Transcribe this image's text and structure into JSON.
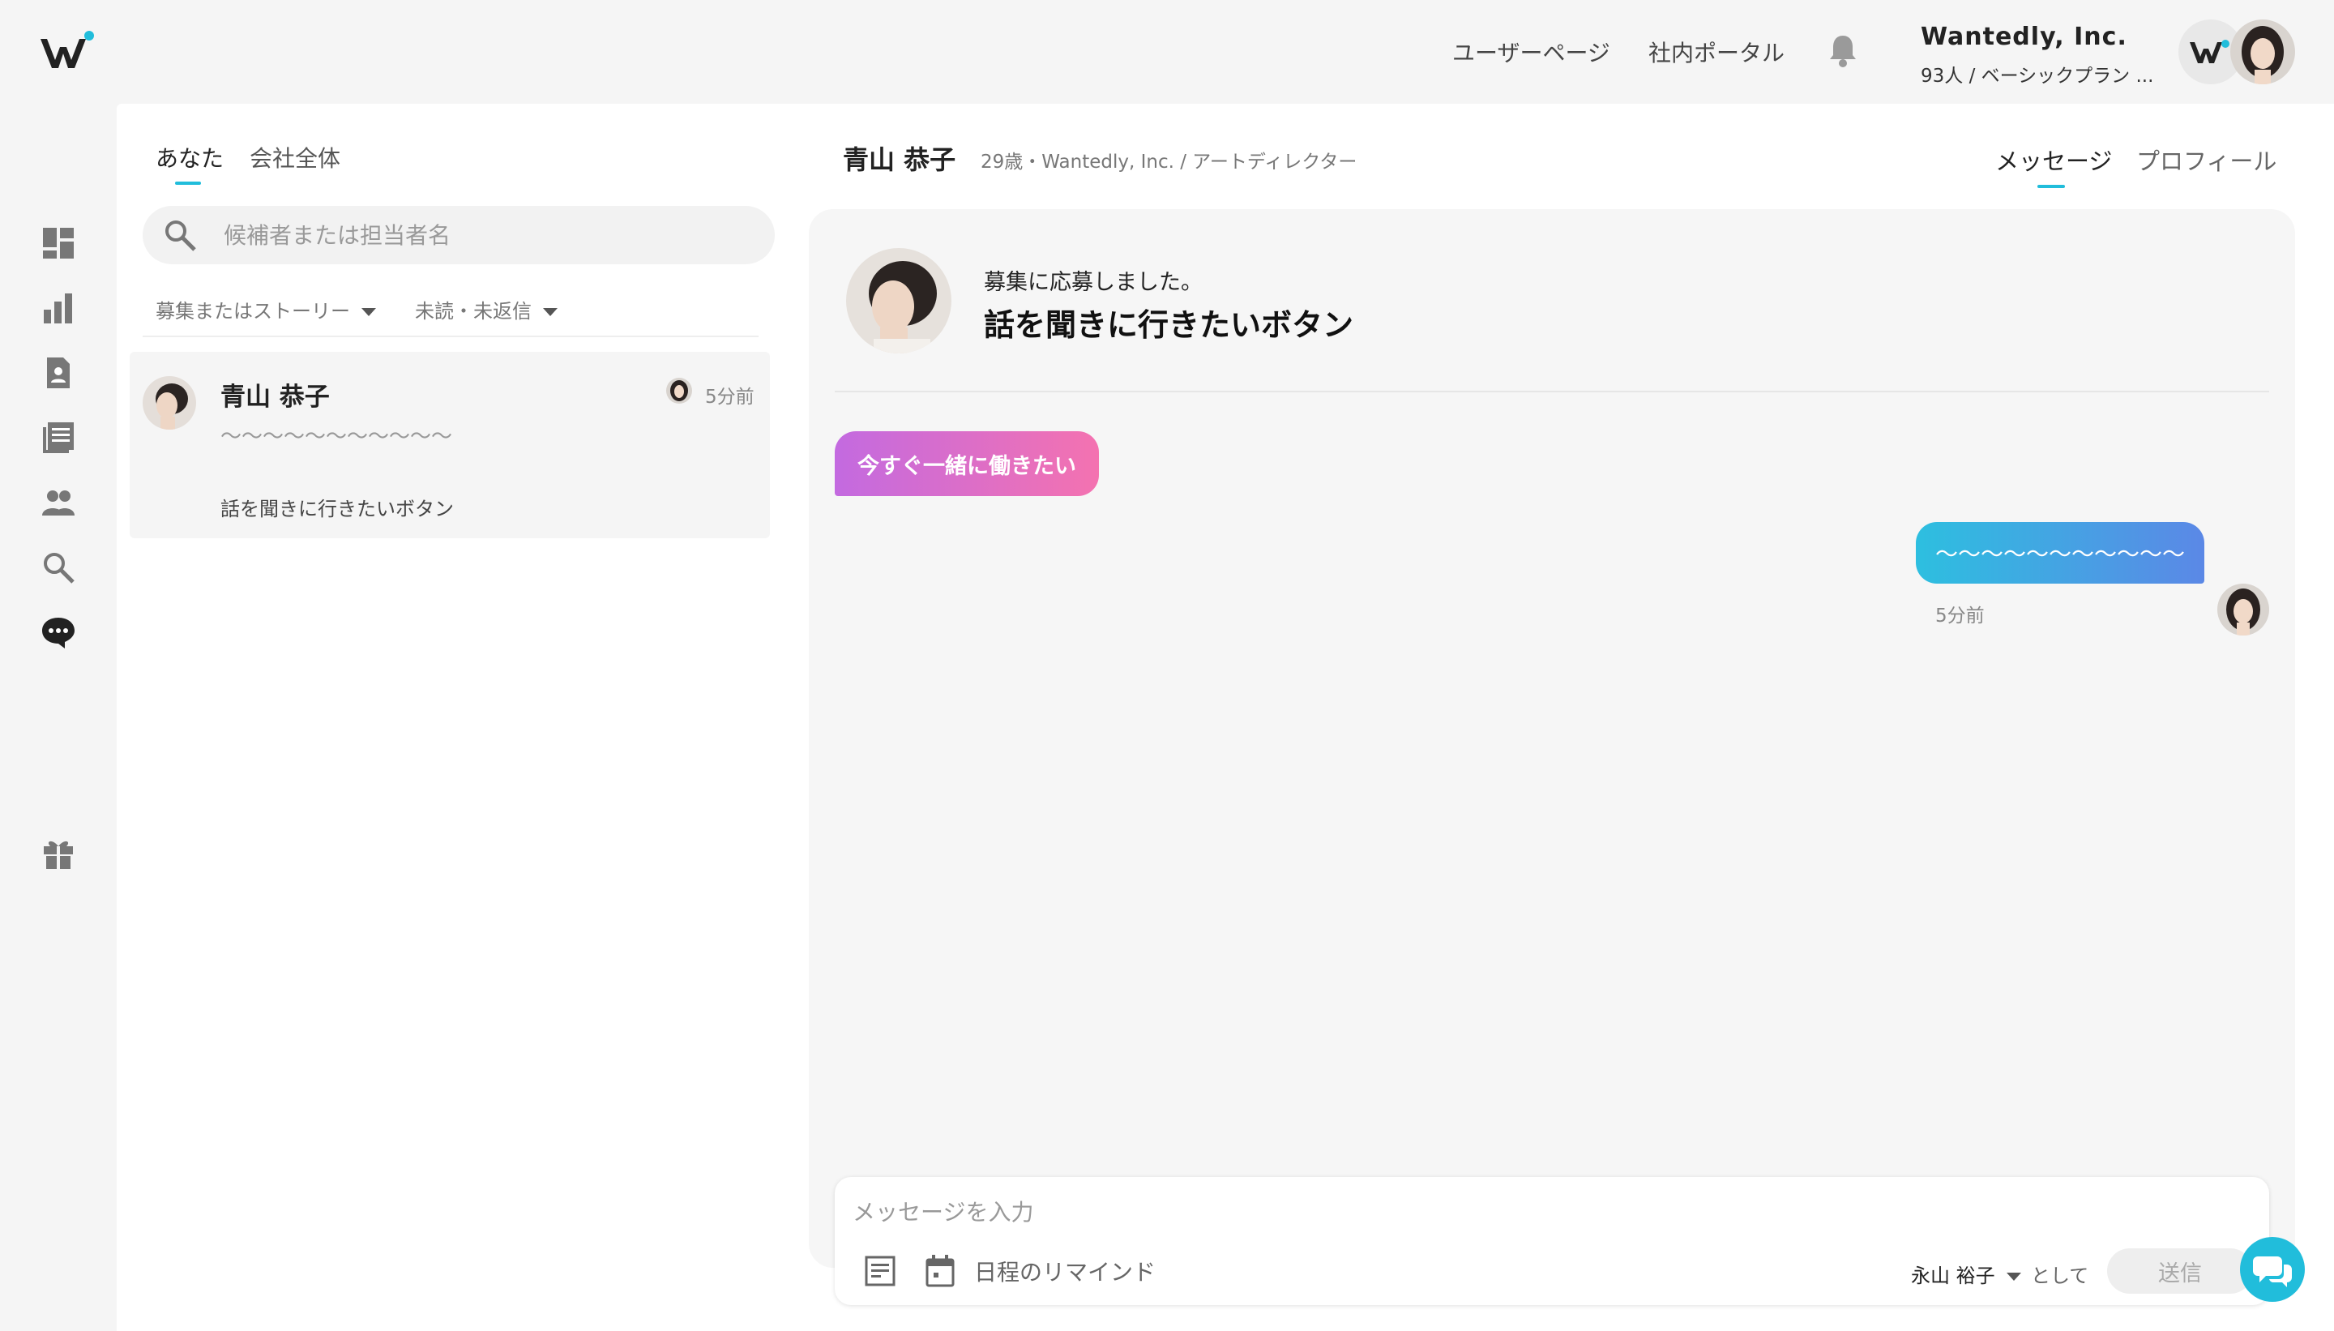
{
  "header": {
    "nav": [
      "ユーザーページ",
      "社内ポータル"
    ],
    "company_name": "Wantedly, Inc.",
    "company_plan": "93人 / ベーシックプラン ..."
  },
  "sidebar_icons": [
    "dashboard-icon",
    "analytics-icon",
    "candidate-icon",
    "stories-icon",
    "members-icon",
    "search-icon",
    "messages-icon",
    "gift-icon"
  ],
  "conversations": {
    "tabs": [
      "あなた",
      "会社全体"
    ],
    "search_placeholder": "候補者または担当者名",
    "filters": [
      "募集またはストーリー",
      "未読・未返信"
    ],
    "items": [
      {
        "name": "青山 恭子",
        "time": "5分前",
        "preview": "〜〜〜〜〜〜〜〜〜〜〜",
        "project": "話を聞きに行きたいボタン"
      }
    ]
  },
  "thread": {
    "candidate_name": "青山 恭子",
    "candidate_meta": "29歳・Wantedly, Inc. / アートディレクター",
    "tabs": [
      "メッセージ",
      "プロフィール"
    ],
    "application_sub": "募集に応募しました。",
    "application_title": "話を聞きに行きたいボタン",
    "badge": "今すぐ一緒に働きたい",
    "messages": [
      {
        "text": "〜〜〜〜〜〜〜〜〜〜〜",
        "time": "5分前"
      }
    ]
  },
  "composer": {
    "placeholder": "メッセージを入力",
    "reminder_label": "日程のリマインド",
    "sender": "永山 裕子",
    "as_label": "として",
    "send_label": "送信"
  },
  "colors": {
    "accent": "#21bddb",
    "badge_start": "#c36ae0",
    "badge_end": "#f472b0",
    "bubble_start": "#2dbfe0",
    "bubble_end": "#5b88e6"
  }
}
